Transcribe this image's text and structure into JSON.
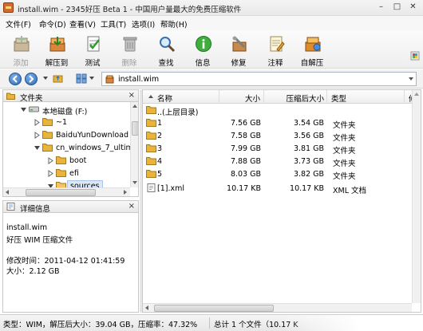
{
  "window": {
    "title": "install.wim - 2345好压 Beta 1 - 中国用户量最大的免费压缩软件",
    "controls": [
      "minimize",
      "maximize",
      "close"
    ]
  },
  "menu": [
    "文件(F)",
    "命令(D)",
    "查看(V)",
    "工具(T)",
    "选项(I)",
    "帮助(H)"
  ],
  "toolbar": {
    "buttons": [
      {
        "label": "添加",
        "icon": "add-icon",
        "enabled": false
      },
      {
        "label": "解压到",
        "icon": "extract-to-icon",
        "enabled": true
      },
      {
        "label": "测试",
        "icon": "test-icon",
        "enabled": true
      },
      {
        "label": "删除",
        "icon": "delete-icon",
        "enabled": false
      },
      {
        "label": "查找",
        "icon": "find-icon",
        "enabled": true
      },
      {
        "label": "信息",
        "icon": "info-icon",
        "enabled": true
      },
      {
        "label": "修复",
        "icon": "repair-icon",
        "enabled": true
      },
      {
        "label": "注释",
        "icon": "comment-icon",
        "enabled": true
      },
      {
        "label": "自解压",
        "icon": "self-extract-icon",
        "enabled": true
      }
    ]
  },
  "address": {
    "path": "install.wim"
  },
  "folder_pane": {
    "title": "文件夹",
    "tree": [
      {
        "label": "本地磁盘 (F:)",
        "level": 0,
        "expanded": true,
        "icon": "drive-icon"
      },
      {
        "label": "~1",
        "level": 1,
        "expanded": false,
        "icon": "folder-icon"
      },
      {
        "label": "BaiduYunDownload",
        "level": 1,
        "expanded": false,
        "icon": "folder-icon"
      },
      {
        "label": "cn_windows_7_ultima",
        "level": 1,
        "expanded": true,
        "icon": "folder-icon"
      },
      {
        "label": "boot",
        "level": 2,
        "expanded": false,
        "icon": "folder-icon"
      },
      {
        "label": "efi",
        "level": 2,
        "expanded": false,
        "icon": "folder-icon"
      },
      {
        "label": "sources",
        "level": 2,
        "expanded": true,
        "icon": "folder-icon",
        "selected": true
      }
    ]
  },
  "details_pane": {
    "title": "详细信息",
    "name": "install.wim",
    "type": "好压 WIM 压缩文件",
    "modified": "修改时间：2011-04-12 01:41:59",
    "size": "大小：2.12 GB"
  },
  "file_list": {
    "columns": [
      "名称",
      "大小",
      "压缩后大小",
      "类型",
      "修改"
    ],
    "rows": [
      {
        "name": "..(上层目录)",
        "size": "",
        "packed": "",
        "type": "",
        "icon": "folder-up-icon"
      },
      {
        "name": "1",
        "size": "7.56 GB",
        "packed": "3.54 GB",
        "type": "文件夹",
        "icon": "folder-icon"
      },
      {
        "name": "2",
        "size": "7.58 GB",
        "packed": "3.56 GB",
        "type": "文件夹",
        "icon": "folder-icon"
      },
      {
        "name": "3",
        "size": "7.99 GB",
        "packed": "3.81 GB",
        "type": "文件夹",
        "icon": "folder-icon"
      },
      {
        "name": "4",
        "size": "7.88 GB",
        "packed": "3.73 GB",
        "type": "文件夹",
        "icon": "folder-icon"
      },
      {
        "name": "5",
        "size": "8.03 GB",
        "packed": "3.82 GB",
        "type": "文件夹",
        "icon": "folder-icon"
      },
      {
        "name": "[1].xml",
        "size": "10.17 KB",
        "packed": "10.17 KB",
        "type": "XML 文档",
        "icon": "xml-file-icon"
      }
    ]
  },
  "status": {
    "left": "类型：WIM，解压后大小：39.04 GB，压缩率：47.32%",
    "right": "总计 1 个文件（10.17 K"
  },
  "colors": {
    "folder": "#e8b43c",
    "selection": "#dbe8f8",
    "nav_blue": "#2e6ab5"
  }
}
